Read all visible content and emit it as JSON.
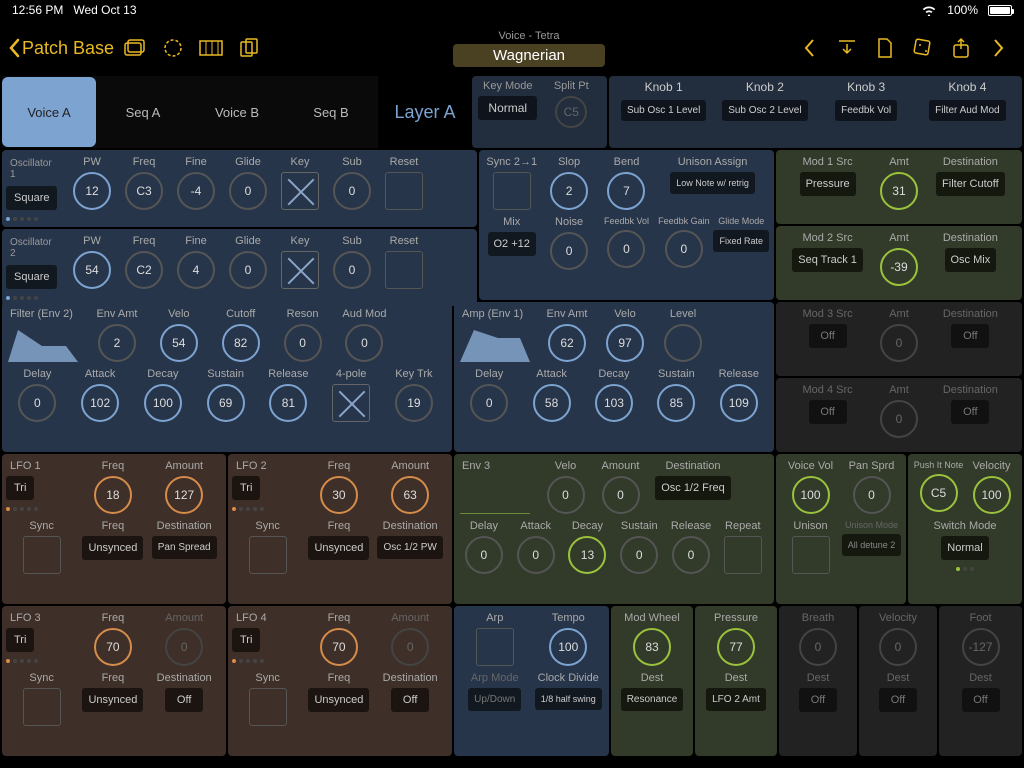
{
  "status": {
    "time": "12:56 PM",
    "date": "Wed Oct 13",
    "battery": "100%"
  },
  "nav": {
    "back": "Patch Base"
  },
  "patch": {
    "subtitle": "Voice - Tetra",
    "title": "Wagnerian"
  },
  "tabs": [
    "Voice A",
    "Seq A",
    "Voice B",
    "Seq B"
  ],
  "layer": "Layer A",
  "keymode": {
    "key_label": "Key Mode",
    "key_value": "Normal",
    "split_label": "Split Pt",
    "split_value": "C5"
  },
  "knobs": [
    {
      "label": "Knob 1",
      "value": "Sub Osc 1 Level"
    },
    {
      "label": "Knob 2",
      "value": "Sub Osc 2 Level"
    },
    {
      "label": "Knob 3",
      "value": "Feedbk Vol"
    },
    {
      "label": "Knob 4",
      "value": "Filter Aud Mod"
    }
  ],
  "osc1": {
    "title": "Oscillator 1",
    "wave": "Square",
    "pw": "12",
    "freq": "C3",
    "fine": "-4",
    "glide": "0",
    "sub": "0",
    "labels": {
      "pw": "PW",
      "freq": "Freq",
      "fine": "Fine",
      "glide": "Glide",
      "key": "Key",
      "sub": "Sub",
      "reset": "Reset"
    }
  },
  "osc2": {
    "title": "Oscillator 2",
    "wave": "Square",
    "pw": "54",
    "freq": "C2",
    "fine": "4",
    "glide": "0",
    "sub": "0",
    "labels": {
      "pw": "PW",
      "freq": "Freq",
      "fine": "Fine",
      "glide": "Glide",
      "key": "Key",
      "sub": "Sub",
      "reset": "Reset"
    }
  },
  "syncbox": {
    "labels": {
      "sync": "Sync 2→1",
      "slop": "Slop",
      "bend": "Bend",
      "ua": "Unison Assign",
      "mix": "Mix",
      "noise": "Noise",
      "fbv": "Feedbk Vol",
      "fbg": "Feedbk Gain",
      "gm": "Glide Mode"
    },
    "slop": "2",
    "bend": "7",
    "ua": "Low Note w/ retrig",
    "mix": "O2 +12",
    "noise": "0",
    "fbv": "0",
    "fbg": "0",
    "gm": "Fixed Rate"
  },
  "mod1": {
    "labels": {
      "src": "Mod 1 Src",
      "amt": "Amt",
      "dest": "Destination"
    },
    "src": "Pressure",
    "amt": "31",
    "dest": "Filter Cutoff"
  },
  "mod2": {
    "labels": {
      "src": "Mod 2 Src",
      "amt": "Amt",
      "dest": "Destination"
    },
    "src": "Seq Track 1",
    "amt": "-39",
    "dest": "Osc Mix"
  },
  "mod3": {
    "labels": {
      "src": "Mod 3 Src",
      "amt": "Amt",
      "dest": "Destination"
    },
    "src": "Off",
    "amt": "0",
    "dest": "Off"
  },
  "mod4": {
    "labels": {
      "src": "Mod 4 Src",
      "amt": "Amt",
      "dest": "Destination"
    },
    "src": "Off",
    "amt": "0",
    "dest": "Off"
  },
  "filter": {
    "title": "Filter (Env 2)",
    "labels": {
      "envamt": "Env Amt",
      "velo": "Velo",
      "cutoff": "Cutoff",
      "reson": "Reson",
      "audmod": "Aud Mod",
      "delay": "Delay",
      "attack": "Attack",
      "decay": "Decay",
      "sustain": "Sustain",
      "release": "Release",
      "pole": "4-pole",
      "keytrk": "Key Trk"
    },
    "envamt": "2",
    "velo": "54",
    "cutoff": "82",
    "reson": "0",
    "audmod": "0",
    "delay": "0",
    "attack": "102",
    "decay": "100",
    "sustain": "69",
    "release": "81",
    "keytrk": "19"
  },
  "amp": {
    "title": "Amp (Env 1)",
    "labels": {
      "envamt": "Env Amt",
      "velo": "Velo",
      "level": "Level",
      "delay": "Delay",
      "attack": "Attack",
      "decay": "Decay",
      "sustain": "Sustain",
      "release": "Release"
    },
    "envamt": "62",
    "velo": "97",
    "delay": "0",
    "attack": "58",
    "decay": "103",
    "sustain": "85",
    "release": "109"
  },
  "lfo1": {
    "title": "LFO 1",
    "wave": "Tri",
    "freq": "18",
    "amount": "127",
    "sync": "",
    "freq2": "Unsynced",
    "dest": "Pan Spread",
    "labels": {
      "freq": "Freq",
      "amount": "Amount",
      "sync": "Sync",
      "freq2": "Freq",
      "dest": "Destination"
    }
  },
  "lfo2": {
    "title": "LFO 2",
    "wave": "Tri",
    "freq": "30",
    "amount": "63",
    "sync": "",
    "freq2": "Unsynced",
    "dest": "Osc 1/2 PW",
    "labels": {
      "freq": "Freq",
      "amount": "Amount",
      "sync": "Sync",
      "freq2": "Freq",
      "dest": "Destination"
    }
  },
  "lfo3": {
    "title": "LFO 3",
    "wave": "Tri",
    "freq": "70",
    "amount": "0",
    "sync": "",
    "freq2": "Unsynced",
    "dest": "Off",
    "labels": {
      "freq": "Freq",
      "amount": "Amount",
      "sync": "Sync",
      "freq2": "Freq",
      "dest": "Destination"
    }
  },
  "lfo4": {
    "title": "LFO 4",
    "wave": "Tri",
    "freq": "70",
    "amount": "0",
    "sync": "",
    "freq2": "Unsynced",
    "dest": "Off",
    "labels": {
      "freq": "Freq",
      "amount": "Amount",
      "sync": "Sync",
      "freq2": "Freq",
      "dest": "Destination"
    }
  },
  "env3": {
    "title": "Env 3",
    "labels": {
      "velo": "Velo",
      "amount": "Amount",
      "dest": "Destination",
      "delay": "Delay",
      "attack": "Attack",
      "decay": "Decay",
      "sustain": "Sustain",
      "release": "Release",
      "repeat": "Repeat"
    },
    "velo": "0",
    "amount": "0",
    "dest": "Osc 1/2 Freq",
    "delay": "0",
    "attack": "0",
    "decay": "13",
    "sustain": "0",
    "release": "0"
  },
  "voice": {
    "labels": {
      "vol": "Voice Vol",
      "pan": "Pan Sprd",
      "unison": "Unison",
      "umode": "Unison Mode"
    },
    "vol": "100",
    "pan": "0",
    "umode": "All detune 2"
  },
  "push": {
    "labels": {
      "note": "Push It Note",
      "velo": "Velocity",
      "mode": "Switch Mode"
    },
    "note": "C5",
    "velo": "100",
    "mode": "Normal"
  },
  "arp": {
    "labels": {
      "arp": "Arp",
      "tempo": "Tempo",
      "mode": "Arp Mode",
      "clock": "Clock Divide"
    },
    "tempo": "100",
    "mode": "Up/Down",
    "clock": "1/8 half swing"
  },
  "modw": {
    "label": "Mod Wheel",
    "value": "83",
    "destl": "Dest",
    "dest": "Resonance"
  },
  "press": {
    "label": "Pressure",
    "value": "77",
    "destl": "Dest",
    "dest": "LFO 2 Amt"
  },
  "breath": {
    "label": "Breath",
    "value": "0",
    "destl": "Dest",
    "dest": "Off"
  },
  "velocity": {
    "label": "Velocity",
    "value": "0",
    "destl": "Dest",
    "dest": "Off"
  },
  "foot": {
    "label": "Foot",
    "value": "-127",
    "destl": "Dest",
    "dest": "Off"
  }
}
